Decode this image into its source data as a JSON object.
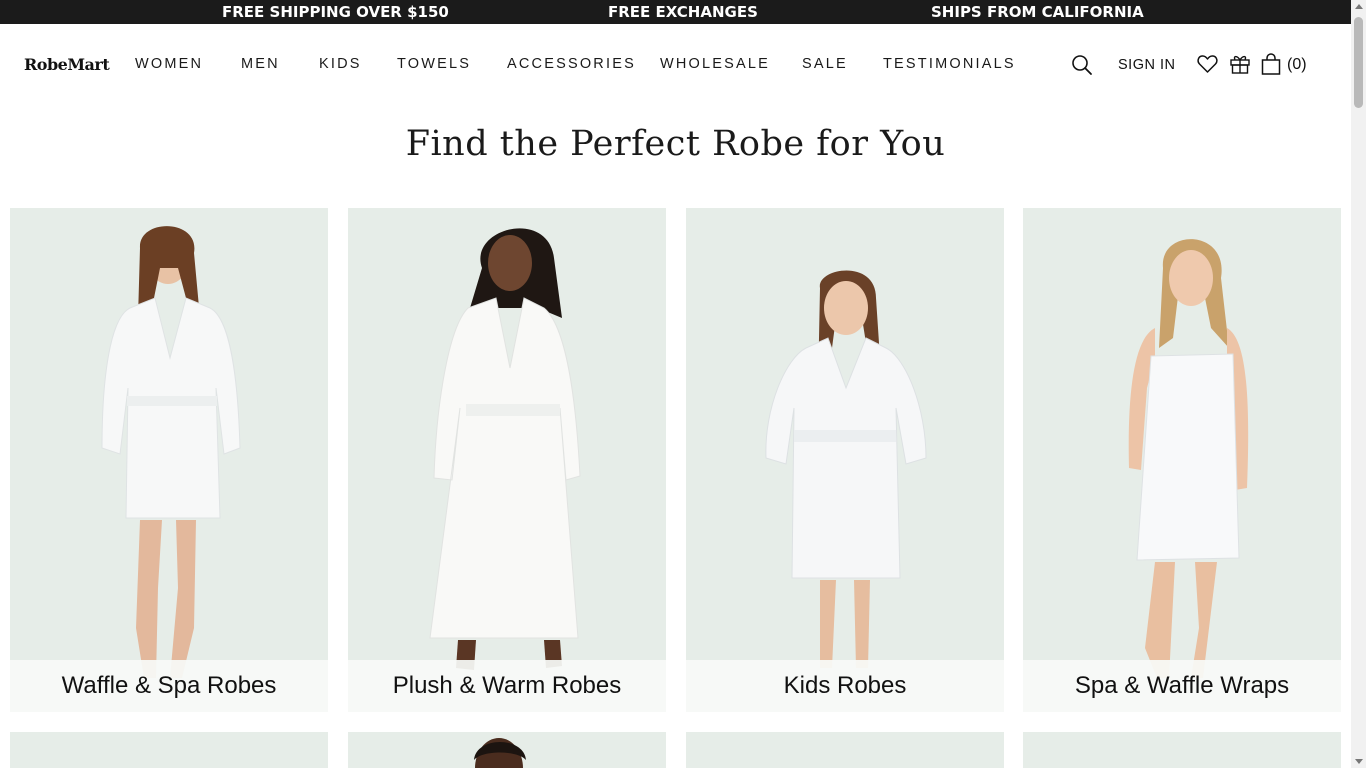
{
  "announcement": {
    "items": [
      "FREE SHIPPING OVER $150",
      "FREE EXCHANGES",
      "SHIPS FROM CALIFORNIA"
    ]
  },
  "header": {
    "logo": "RobeMart",
    "nav": [
      "WOMEN",
      "MEN",
      "KIDS",
      "TOWELS",
      "ACCESSORIES",
      "WHOLESALE",
      "SALE",
      "TESTIMONIALS"
    ],
    "sign_in": "SIGN IN",
    "cart_count": "(0)",
    "icons": [
      "search-icon",
      "heart-icon",
      "gift-icon",
      "bag-icon"
    ]
  },
  "main": {
    "title": "Find the Perfect Robe for You",
    "categories": [
      {
        "label": "Waffle & Spa Robes"
      },
      {
        "label": "Plush & Warm Robes"
      },
      {
        "label": "Kids Robes"
      },
      {
        "label": "Spa & Waffle Wraps"
      }
    ]
  },
  "colors": {
    "announcement_bg": "#1b1b1b",
    "tile_bg": "#e6ede8",
    "text": "#111111"
  }
}
